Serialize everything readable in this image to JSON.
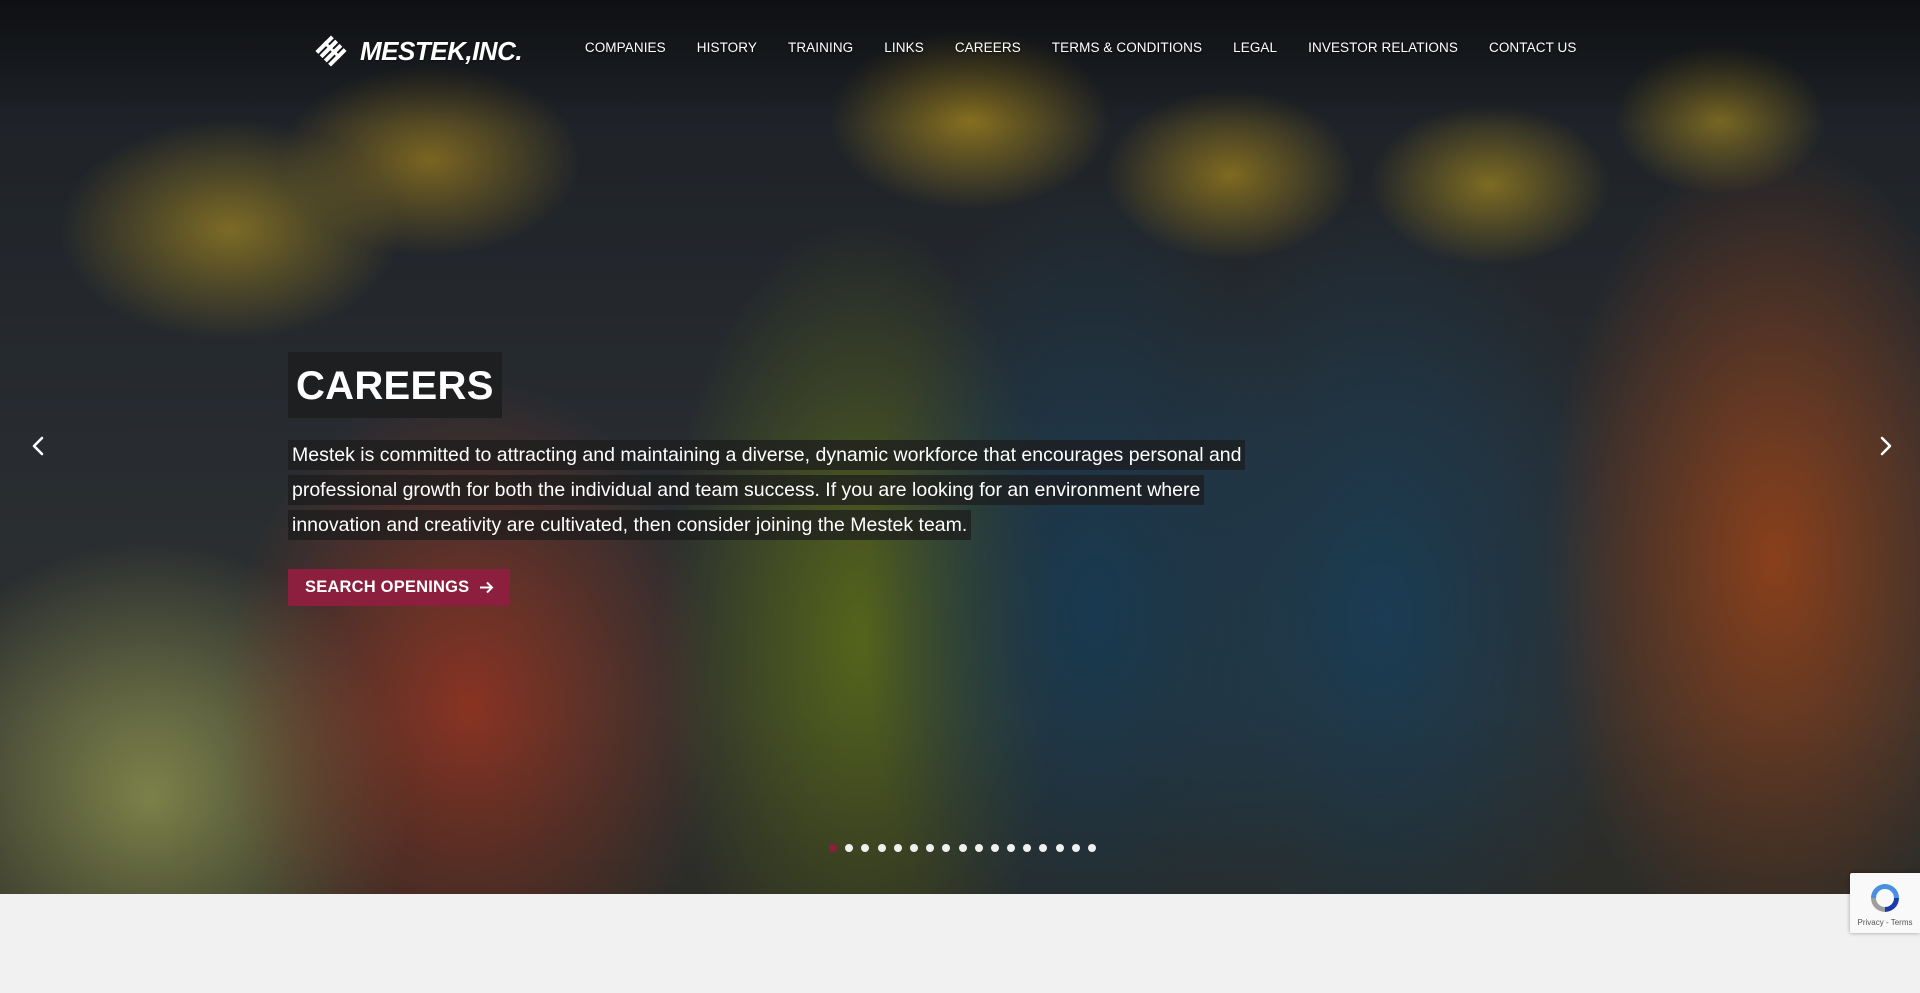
{
  "brand": {
    "logo_text": "MESTEK,INC.",
    "accent_color": "#8c1f3d"
  },
  "nav": {
    "items": [
      "COMPANIES",
      "HISTORY",
      "TRAINING",
      "LINKS",
      "CAREERS",
      "TERMS & CONDITIONS",
      "LEGAL",
      "INVESTOR RELATIONS",
      "CONTACT US"
    ]
  },
  "hero": {
    "title": "CAREERS",
    "description": "Mestek is committed to attracting and maintaining a diverse, dynamic workforce that encourages personal and professional growth for both the individual and team success. If you are looking for an environment where innovation and creativity are cultivated, then consider joining the Mestek team.",
    "cta_label": "SEARCH OPENINGS",
    "cta_icon": "arrow-right-icon",
    "prev_icon": "chevron-left-icon",
    "next_icon": "chevron-right-icon"
  },
  "carousel": {
    "slide_count": 17,
    "active_index": 0
  },
  "recaptcha": {
    "links": "Privacy - Terms"
  }
}
